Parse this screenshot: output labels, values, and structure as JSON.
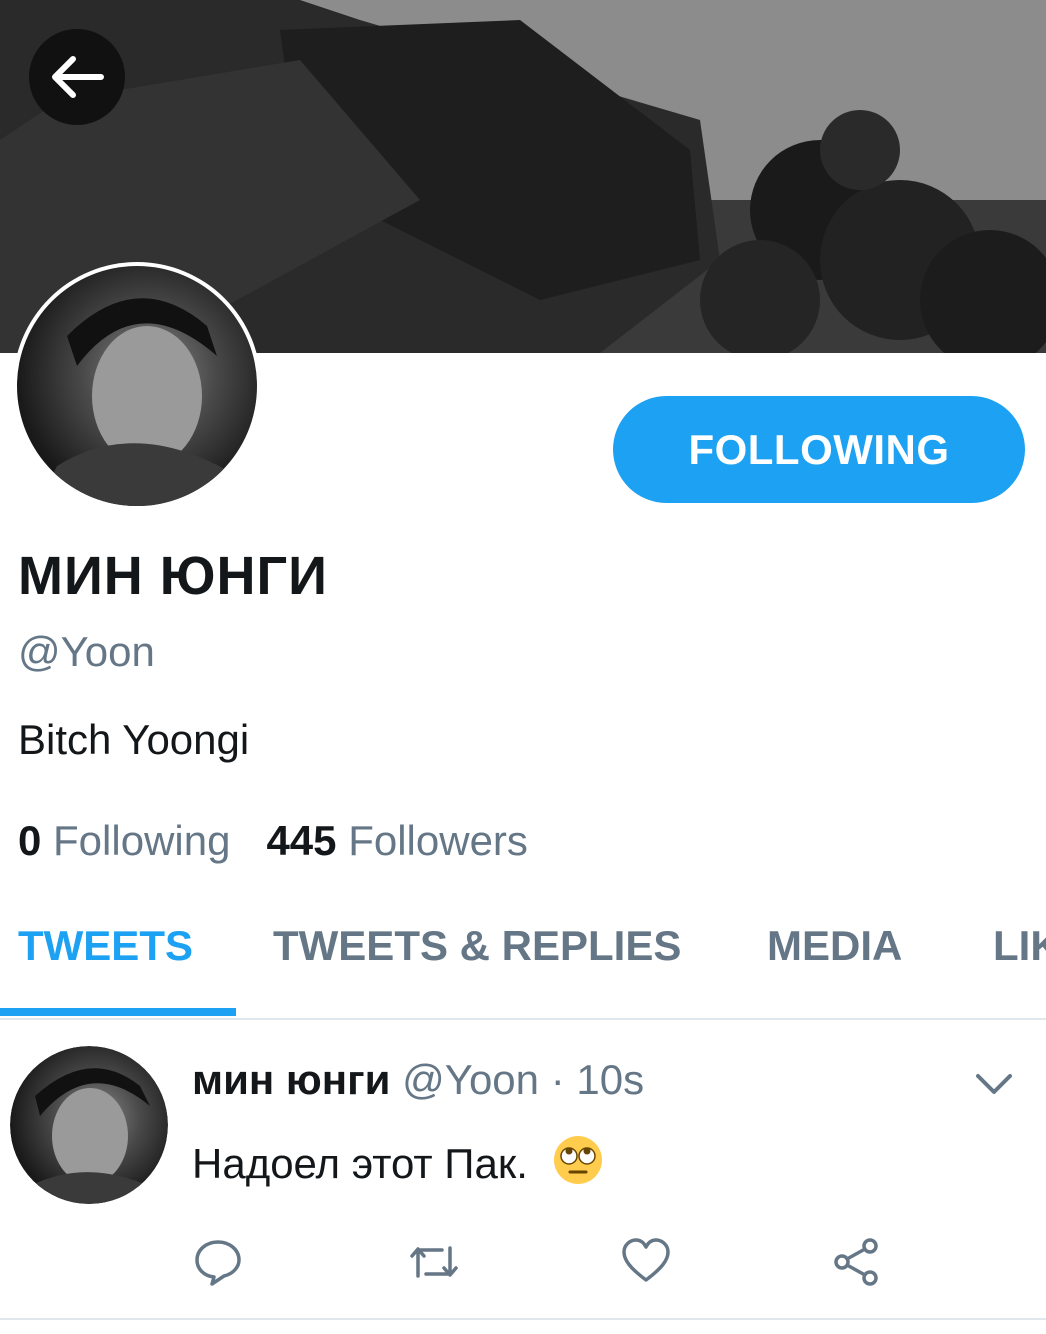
{
  "header": {
    "back_icon": "arrow-left-icon",
    "banner_image": "black-and-white ruins with trees"
  },
  "profile": {
    "display_name": "МИН ЮНГИ",
    "handle": "@Yoon",
    "bio": "Bitch Yoongi",
    "follow_button_label": "FOLLOWING",
    "following_count": "0",
    "following_label": "Following",
    "followers_count": "445",
    "followers_label": "Followers"
  },
  "tabs": [
    {
      "label": "TWEETS",
      "active": true
    },
    {
      "label": "TWEETS & REPLIES",
      "active": false
    },
    {
      "label": "MEDIA",
      "active": false
    },
    {
      "label": "LIKES",
      "active": false
    }
  ],
  "tweets": [
    {
      "author_name": "мин юнги",
      "author_handle": "@Yoon",
      "separator": "·",
      "time": "10s",
      "text": "Надоел этот Пак.",
      "emoji": "face-with-rolling-eyes",
      "actions": [
        "reply-icon",
        "retweet-icon",
        "like-icon",
        "share-icon"
      ]
    }
  ],
  "colors": {
    "accent": "#1da1f2",
    "secondary_text": "#657786",
    "primary_text": "#14171a"
  }
}
